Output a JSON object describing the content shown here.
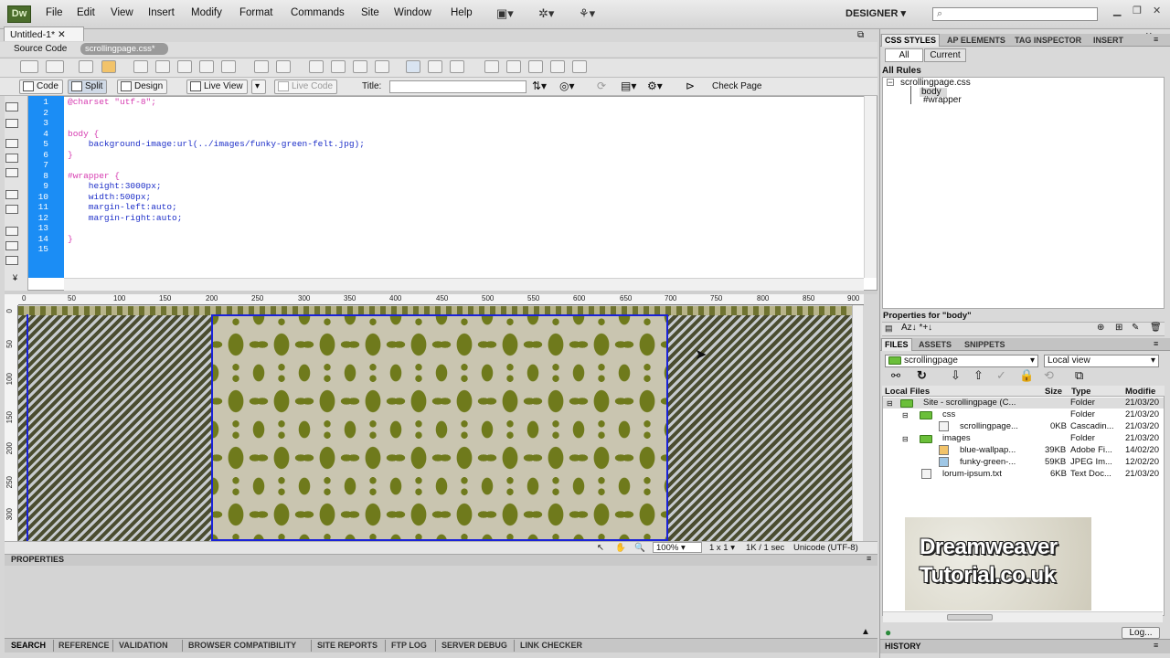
{
  "app": {
    "logo": "Dw",
    "workspace": "DESIGNER"
  },
  "menu": [
    "File",
    "Edit",
    "View",
    "Insert",
    "Modify",
    "Format",
    "Commands",
    "Site",
    "Window",
    "Help"
  ],
  "document": {
    "tab": "Untitled-1*",
    "source_code_label": "Source Code",
    "related_file": "scrollingpage.css*"
  },
  "doc_toolbar": {
    "code": "Code",
    "split": "Split",
    "design": "Design",
    "live_view": "Live View",
    "live_code": "Live Code",
    "title_label": "Title:",
    "title_value": "",
    "check_page": "Check Page"
  },
  "code": {
    "line_numbers": [
      "1",
      "2",
      "3",
      "4",
      "5",
      "6",
      "7",
      "8",
      "9",
      "10",
      "11",
      "12",
      "13",
      "14",
      "15"
    ],
    "lines": [
      "@charset \"utf-8\";",
      "",
      "",
      "body {",
      "    background-image:url(../images/funky-green-felt.jpg);",
      "}",
      "",
      "#wrapper {",
      "    height:3000px;",
      "    width:500px;",
      "    margin-left:auto;",
      "    margin-right:auto;",
      "",
      "}",
      ""
    ]
  },
  "ruler": {
    "h": [
      "0",
      "50",
      "100",
      "150",
      "200",
      "250",
      "300",
      "350",
      "400",
      "450",
      "500",
      "550",
      "600",
      "650",
      "700",
      "750",
      "800",
      "850",
      "900"
    ],
    "v": [
      "0",
      "50",
      "100",
      "150",
      "200",
      "250",
      "300"
    ]
  },
  "status": {
    "zoom": "100%",
    "scale": "1 x 1",
    "size": "1K / 1 sec",
    "encoding": "Unicode (UTF-8)"
  },
  "properties": {
    "title": "PROPERTIES"
  },
  "results_tabs": [
    "SEARCH",
    "REFERENCE",
    "VALIDATION",
    "BROWSER COMPATIBILITY",
    "SITE REPORTS",
    "FTP LOG",
    "SERVER DEBUG",
    "LINK CHECKER"
  ],
  "css_panel": {
    "tabs": [
      "CSS STYLES",
      "AP ELEMENTS",
      "TAG INSPECTOR",
      "INSERT"
    ],
    "all": "All",
    "current": "Current",
    "all_rules": "All Rules",
    "rules": [
      "scrollingpage.css",
      "body",
      "#wrapper"
    ],
    "props_for": "Properties for \"body\"",
    "prop_icons": "Az↓ *+↓"
  },
  "files_panel": {
    "tabs": [
      "FILES",
      "ASSETS",
      "SNIPPETS"
    ],
    "site": "scrollingpage",
    "view": "Local view",
    "headers": [
      "Local Files",
      "Size",
      "Type",
      "Modifie"
    ],
    "rows": [
      {
        "name": "Site - scrollingpage (C...",
        "size": "",
        "type": "Folder",
        "mod": "21/03/20"
      },
      {
        "name": "css",
        "size": "",
        "type": "Folder",
        "mod": "21/03/20"
      },
      {
        "name": "scrollingpage...",
        "size": "0KB",
        "type": "Cascadin...",
        "mod": "21/03/20"
      },
      {
        "name": "images",
        "size": "",
        "type": "Folder",
        "mod": "21/03/20"
      },
      {
        "name": "blue-wallpap...",
        "size": "39KB",
        "type": "Adobe Fi...",
        "mod": "14/02/20"
      },
      {
        "name": "funky-green-...",
        "size": "59KB",
        "type": "JPEG Im...",
        "mod": "12/02/20"
      },
      {
        "name": "lorum-ipsum.txt",
        "size": "6KB",
        "type": "Text Doc...",
        "mod": "21/03/20"
      }
    ],
    "log": "Log...",
    "watermark_line1": "Dreamweaver",
    "watermark_line2": "Tutorial.co.uk"
  },
  "history": "HISTORY"
}
